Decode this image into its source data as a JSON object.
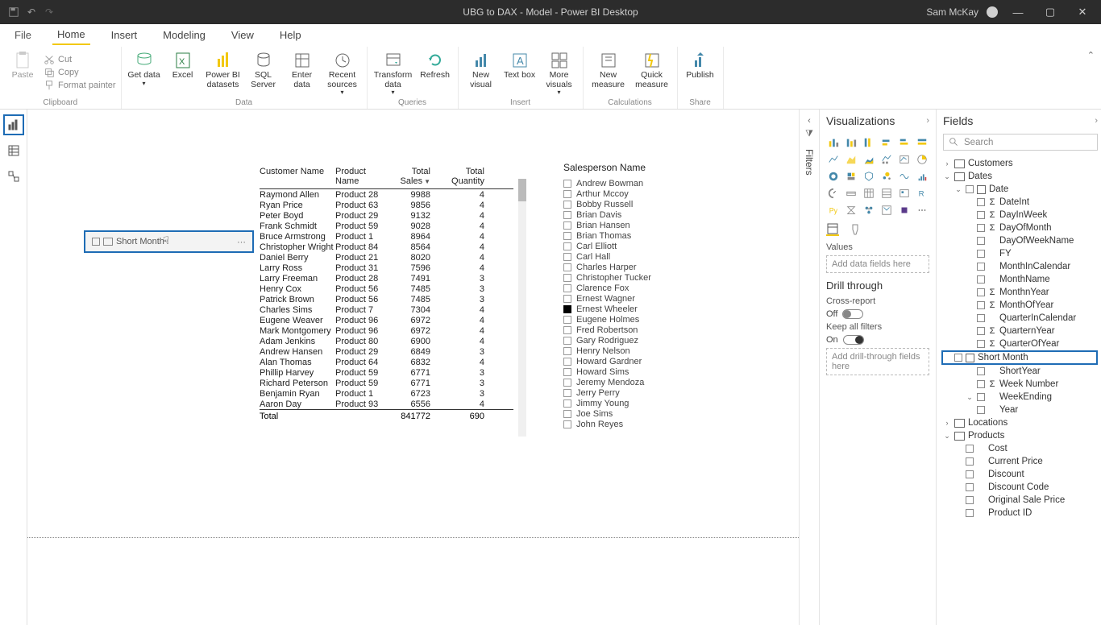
{
  "titlebar": {
    "title": "UBG to DAX - Model - Power BI Desktop",
    "user": "Sam McKay"
  },
  "menu": {
    "file": "File",
    "tabs": [
      "Home",
      "Insert",
      "Modeling",
      "View",
      "Help"
    ],
    "active": "Home"
  },
  "ribbon": {
    "clipboard": {
      "label": "Clipboard",
      "paste": "Paste",
      "cut": "Cut",
      "copy": "Copy",
      "fmt": "Format painter"
    },
    "data": {
      "label": "Data",
      "get": "Get data",
      "excel": "Excel",
      "pbids": "Power BI datasets",
      "sql": "SQL Server",
      "enter": "Enter data",
      "recent": "Recent sources"
    },
    "queries": {
      "label": "Queries",
      "transform": "Transform data",
      "refresh": "Refresh"
    },
    "insert": {
      "label": "Insert",
      "newv": "New visual",
      "textbox": "Text box",
      "morev": "More visuals"
    },
    "calc": {
      "label": "Calculations",
      "newm": "New measure",
      "quickm": "Quick measure"
    },
    "share": {
      "label": "Share",
      "publish": "Publish"
    }
  },
  "shortmonth_chip": "Short Month",
  "table": {
    "headers": [
      "Customer Name",
      "Product Name",
      "Total Sales",
      "Total Quantity"
    ],
    "rows": [
      [
        "Raymond Allen",
        "Product 28",
        "9988",
        "4"
      ],
      [
        "Ryan Price",
        "Product 63",
        "9856",
        "4"
      ],
      [
        "Peter Boyd",
        "Product 29",
        "9132",
        "4"
      ],
      [
        "Frank Schmidt",
        "Product 59",
        "9028",
        "4"
      ],
      [
        "Bruce Armstrong",
        "Product 1",
        "8964",
        "4"
      ],
      [
        "Christopher Wright",
        "Product 84",
        "8564",
        "4"
      ],
      [
        "Daniel Berry",
        "Product 21",
        "8020",
        "4"
      ],
      [
        "Larry Ross",
        "Product 31",
        "7596",
        "4"
      ],
      [
        "Larry Freeman",
        "Product 28",
        "7491",
        "3"
      ],
      [
        "Henry Cox",
        "Product 56",
        "7485",
        "3"
      ],
      [
        "Patrick Brown",
        "Product 56",
        "7485",
        "3"
      ],
      [
        "Charles Sims",
        "Product 7",
        "7304",
        "4"
      ],
      [
        "Eugene Weaver",
        "Product 96",
        "6972",
        "4"
      ],
      [
        "Mark Montgomery",
        "Product 96",
        "6972",
        "4"
      ],
      [
        "Adam Jenkins",
        "Product 80",
        "6900",
        "4"
      ],
      [
        "Andrew Hansen",
        "Product 29",
        "6849",
        "3"
      ],
      [
        "Alan Thomas",
        "Product 64",
        "6832",
        "4"
      ],
      [
        "Phillip Harvey",
        "Product 59",
        "6771",
        "3"
      ],
      [
        "Richard Peterson",
        "Product 59",
        "6771",
        "3"
      ],
      [
        "Benjamin Ryan",
        "Product 1",
        "6723",
        "3"
      ],
      [
        "Aaron Day",
        "Product 93",
        "6556",
        "4"
      ]
    ],
    "total_label": "Total",
    "total_sales": "841772",
    "total_qty": "690"
  },
  "slicer": {
    "title": "Salesperson Name",
    "items": [
      "Andrew Bowman",
      "Arthur Mccoy",
      "Bobby Russell",
      "Brian Davis",
      "Brian Hansen",
      "Brian Thomas",
      "Carl Elliott",
      "Carl Hall",
      "Charles Harper",
      "Christopher Tucker",
      "Clarence Fox",
      "Ernest Wagner",
      "Ernest Wheeler",
      "Eugene Holmes",
      "Fred Robertson",
      "Gary Rodriguez",
      "Henry Nelson",
      "Howard Gardner",
      "Howard Sims",
      "Jeremy Mendoza",
      "Jerry Perry",
      "Jimmy Young",
      "Joe Sims",
      "John Reyes"
    ],
    "checked_index": 12
  },
  "vizpane": {
    "title": "Visualizations",
    "values": "Values",
    "values_placeholder": "Add data fields here",
    "drill": "Drill through",
    "cross": "Cross-report",
    "off": "Off",
    "keep": "Keep all filters",
    "on": "On",
    "drill_placeholder": "Add drill-through fields here"
  },
  "filters": {
    "title": "Filters"
  },
  "fieldspane": {
    "title": "Fields",
    "search": "Search",
    "tables": [
      {
        "name": "Customers",
        "expanded": false
      },
      {
        "name": "Dates",
        "expanded": true,
        "children": [
          {
            "name": "Date",
            "hier": true,
            "expanded": true,
            "children": [
              {
                "name": "DateInt",
                "sigma": true
              },
              {
                "name": "DayInWeek",
                "sigma": true
              },
              {
                "name": "DayOfMonth",
                "sigma": true
              },
              {
                "name": "DayOfWeekName"
              },
              {
                "name": "FY"
              },
              {
                "name": "MonthInCalendar"
              },
              {
                "name": "MonthName"
              },
              {
                "name": "MonthnYear",
                "sigma": true
              },
              {
                "name": "MonthOfYear",
                "sigma": true
              },
              {
                "name": "QuarterInCalendar"
              },
              {
                "name": "QuarternYear",
                "sigma": true
              },
              {
                "name": "QuarterOfYear",
                "sigma": true
              },
              {
                "name": "Short Month",
                "hier_icon": true,
                "highlight": true
              },
              {
                "name": "ShortYear"
              },
              {
                "name": "Week Number",
                "sigma": true
              },
              {
                "name": "WeekEnding",
                "expand": true
              },
              {
                "name": "Year"
              }
            ]
          }
        ]
      },
      {
        "name": "Locations",
        "expanded": false
      },
      {
        "name": "Products",
        "expanded": true,
        "children": [
          {
            "name": "Cost"
          },
          {
            "name": "Current Price"
          },
          {
            "name": "Discount"
          },
          {
            "name": "Discount Code"
          },
          {
            "name": "Original Sale Price"
          },
          {
            "name": "Product ID"
          }
        ]
      }
    ]
  }
}
